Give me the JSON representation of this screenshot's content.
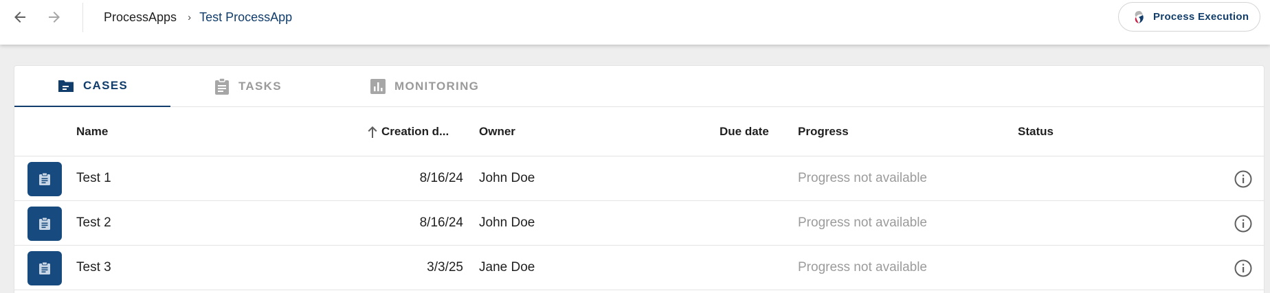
{
  "breadcrumb": {
    "root": "ProcessApps",
    "separator": "›",
    "current": "Test ProcessApp"
  },
  "top_actions": {
    "process_execution_label": "Process Execution"
  },
  "tabs": [
    {
      "label": "CASES",
      "icon": "folder-icon",
      "active": true
    },
    {
      "label": "TASKS",
      "icon": "clipboard-icon",
      "active": false
    },
    {
      "label": "MONITORING",
      "icon": "bar-chart-icon",
      "active": false
    }
  ],
  "table": {
    "columns": {
      "name": "Name",
      "creation_date": "Creation d...",
      "owner": "Owner",
      "due_date": "Due date",
      "progress": "Progress",
      "status": "Status"
    },
    "sort": {
      "column": "creation_date",
      "direction": "ascending"
    },
    "rows": [
      {
        "name": "Test 1",
        "creation_date": "8/16/24",
        "owner": "John Doe",
        "due_date": "",
        "progress": "Progress not available",
        "status": ""
      },
      {
        "name": "Test 2",
        "creation_date": "8/16/24",
        "owner": "John Doe",
        "due_date": "",
        "progress": "Progress not available",
        "status": ""
      },
      {
        "name": "Test 3",
        "creation_date": "3/3/25",
        "owner": "Jane Doe",
        "due_date": "",
        "progress": "Progress not available",
        "status": ""
      }
    ]
  },
  "colors": {
    "accent": "#103d6b",
    "row_icon_bg": "#174a7e",
    "muted_text": "#9b9b9b"
  }
}
